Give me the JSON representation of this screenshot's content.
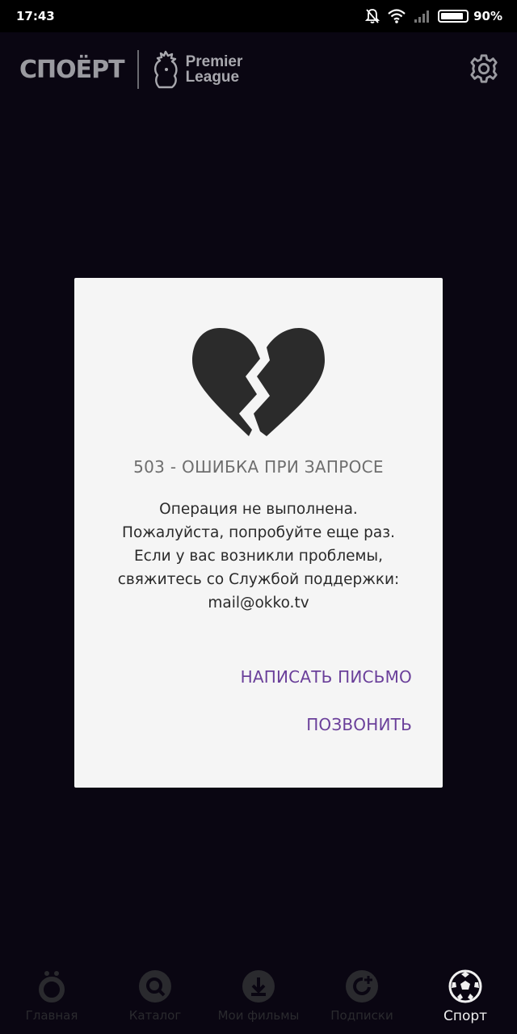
{
  "status_bar": {
    "time": "17:43",
    "battery_percent": "90%",
    "battery_level": 0.9
  },
  "header": {
    "logo_sport": "СПОЁРТ",
    "logo_league_line1": "Premier",
    "logo_league_line2": "League",
    "settings_icon": "gear-icon"
  },
  "dialog": {
    "icon": "broken-heart-icon",
    "title": "503 - ОШИБКА ПРИ ЗАПРОСЕ",
    "message_lines": [
      "Операция не выполнена.",
      "Пожалуйста, попробуйте еще раз.",
      "Если у вас возникли проблемы,",
      "свяжитесь со Службой поддержки:",
      "mail@okko.tv"
    ],
    "button_email": "НАПИСАТЬ ПИСЬМО",
    "button_call": "ПОЗВОНИТЬ"
  },
  "bottom_nav": {
    "items": [
      {
        "label": "Главная",
        "icon": "home-icon"
      },
      {
        "label": "Каталог",
        "icon": "catalog-search-icon"
      },
      {
        "label": "Мои фильмы",
        "icon": "download-icon"
      },
      {
        "label": "Подписки",
        "icon": "subscriptions-icon"
      },
      {
        "label": "Спорт",
        "icon": "soccer-ball-icon"
      }
    ],
    "active_index": 4
  },
  "colors": {
    "background": "#0a0612",
    "dialog_bg": "#f5f5f5",
    "accent_purple": "#6a3f9a",
    "title_gray": "#6e6e6e"
  }
}
